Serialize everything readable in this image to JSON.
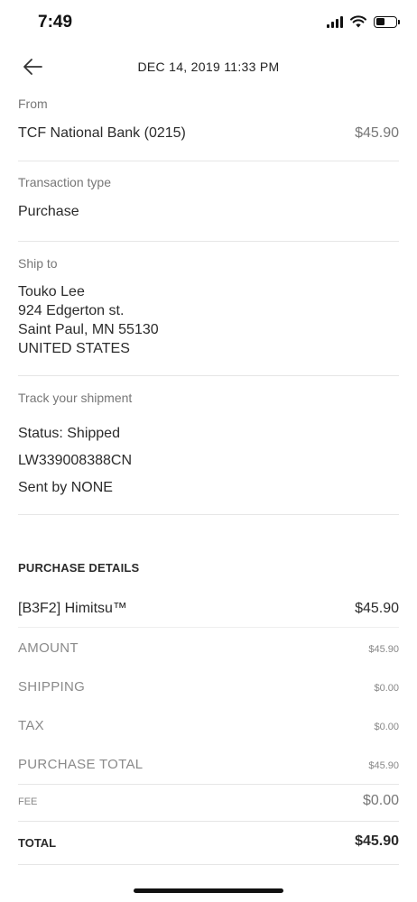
{
  "status_bar": {
    "time": "7:49"
  },
  "header": {
    "date": "DEC 14, 2019  11:33 PM"
  },
  "from": {
    "label": "From",
    "account": "TCF National Bank (0215)",
    "amount": "$45.90"
  },
  "transaction_type": {
    "label": "Transaction type",
    "value": "Purchase"
  },
  "ship_to": {
    "label": "Ship to",
    "name": "Touko Lee",
    "street": "924 Edgerton st.",
    "city": "Saint Paul, MN 55130",
    "country": "UNITED STATES"
  },
  "shipment": {
    "label": "Track your shipment",
    "status": "Status: Shipped",
    "tracking": "LW339008388CN",
    "sent_by": "Sent by NONE"
  },
  "purchase_details": {
    "title": "PURCHASE DETAILS",
    "item_name": "[B3F2] Himitsu™",
    "item_price": "$45.90",
    "amount_label": "AMOUNT",
    "amount_value": "$45.90",
    "shipping_label": "SHIPPING",
    "shipping_value": "$0.00",
    "tax_label": "TAX",
    "tax_value": "$0.00",
    "purchase_total_label": "PURCHASE TOTAL",
    "purchase_total_value": "$45.90",
    "fee_label": "FEE",
    "fee_value": "$0.00",
    "total_label": "TOTAL",
    "total_value": "$45.90"
  }
}
